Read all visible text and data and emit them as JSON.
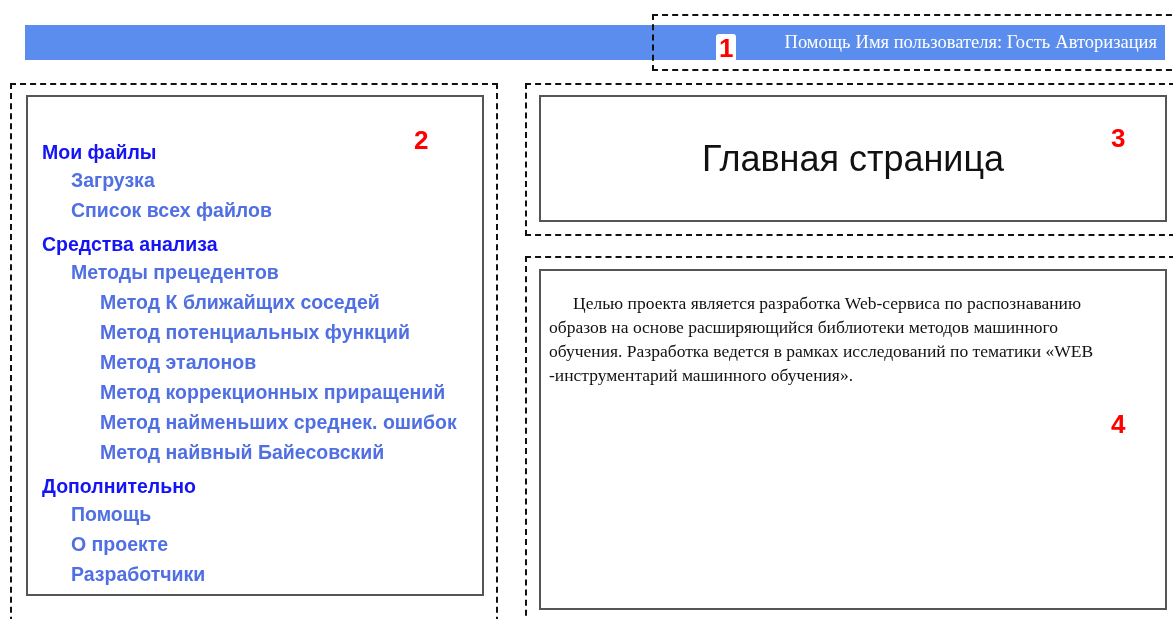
{
  "header": {
    "marker": "1",
    "links": [
      {
        "label": "Помощь"
      },
      {
        "label": "Имя пользователя: Гость"
      },
      {
        "label": "Авторизация"
      }
    ]
  },
  "sidebar": {
    "marker": "2",
    "items": [
      {
        "label": "Мои файлы",
        "kind": "heading",
        "children": [
          {
            "label": "Загрузка",
            "kind": "link"
          },
          {
            "label": "Список всех файлов",
            "kind": "link"
          }
        ]
      },
      {
        "label": "Средства анализа",
        "kind": "heading",
        "children": [
          {
            "label": "Методы прецедентов",
            "kind": "link",
            "children": [
              {
                "label": "Метод К ближайщих соседей",
                "kind": "link"
              },
              {
                "label": "Метод потенциальных функций",
                "kind": "link"
              },
              {
                "label": "Метод эталонов",
                "kind": "link"
              },
              {
                "label": "Метод коррекционных приращений",
                "kind": "link"
              },
              {
                "label": "Метод найменьших среднек. ошибок",
                "kind": "link"
              },
              {
                "label": "Метод найвный Байесовский",
                "kind": "link"
              }
            ]
          }
        ]
      },
      {
        "label": "Дополнительно",
        "kind": "heading",
        "children": [
          {
            "label": "Помощь",
            "kind": "link"
          },
          {
            "label": "О проекте",
            "kind": "link"
          },
          {
            "label": "Разработчики",
            "kind": "link"
          }
        ]
      }
    ]
  },
  "title_panel": {
    "marker": "3",
    "title": "Главная страница"
  },
  "content_panel": {
    "marker": "4",
    "text": "Целью проекта является разработка Web-сервиса по распознаванию образов на основе расширяющийся библиотеки методов машинного обучения. Разработка ведется в рамках исследований по тематики «WEB -инструментарий машинного обучения»."
  }
}
